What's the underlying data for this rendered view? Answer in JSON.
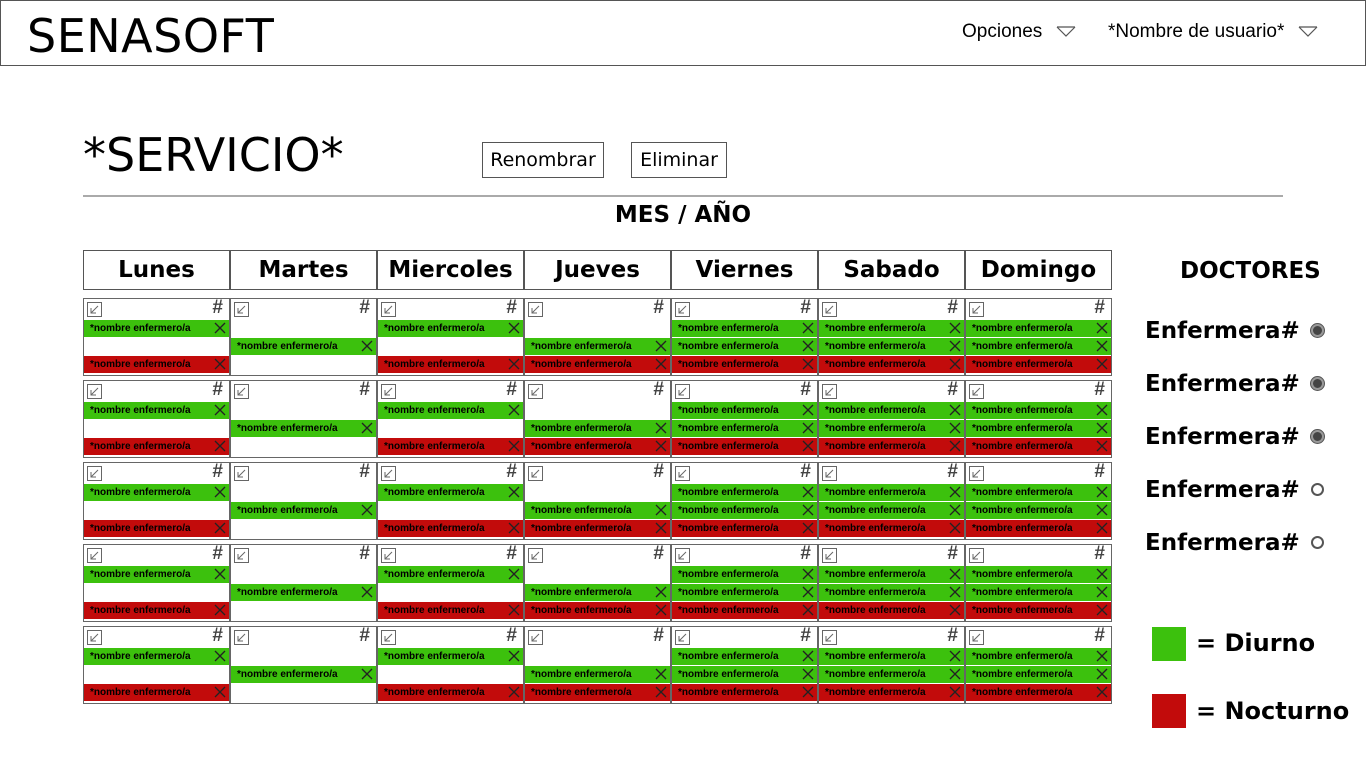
{
  "header": {
    "brand": "SENASOFT",
    "options_label": "Opciones",
    "user_label": "*Nombre de usuario*"
  },
  "service": {
    "title": "*SERVICIO*",
    "rename_label": "Renombrar",
    "delete_label": "Eliminar",
    "period": "MES / AÑO"
  },
  "days": [
    "Lunes",
    "Martes",
    "Miercoles",
    "Jueves",
    "Viernes",
    "Sabado",
    "Domingo"
  ],
  "cell_number_label": "#",
  "shift_name": "*nombre enfermero/a",
  "schedule_pattern": [
    [
      "d",
      "",
      "n"
    ],
    [
      "",
      "d",
      ""
    ],
    [
      "d",
      "",
      "n"
    ],
    [
      "",
      "d",
      "n"
    ],
    [
      "d",
      "d",
      "n"
    ],
    [
      "d",
      "d",
      "n"
    ],
    [
      "d",
      "d",
      "n"
    ]
  ],
  "weeks": 5,
  "doctors": {
    "title": "DOCTORES",
    "items": [
      {
        "label": "Enfermera#",
        "selected": true
      },
      {
        "label": "Enfermera#",
        "selected": true
      },
      {
        "label": "Enfermera#",
        "selected": true
      },
      {
        "label": "Enfermera#",
        "selected": false
      },
      {
        "label": "Enfermera#",
        "selected": false
      }
    ]
  },
  "legend": {
    "day_label": "= Diurno",
    "night_label": "= Nocturno",
    "day_color": "#3cc10d",
    "night_color": "#c20b0b"
  },
  "icons": {
    "dropdown": "chevron-down-icon",
    "expand": "expand-icon",
    "remove": "close-icon"
  }
}
